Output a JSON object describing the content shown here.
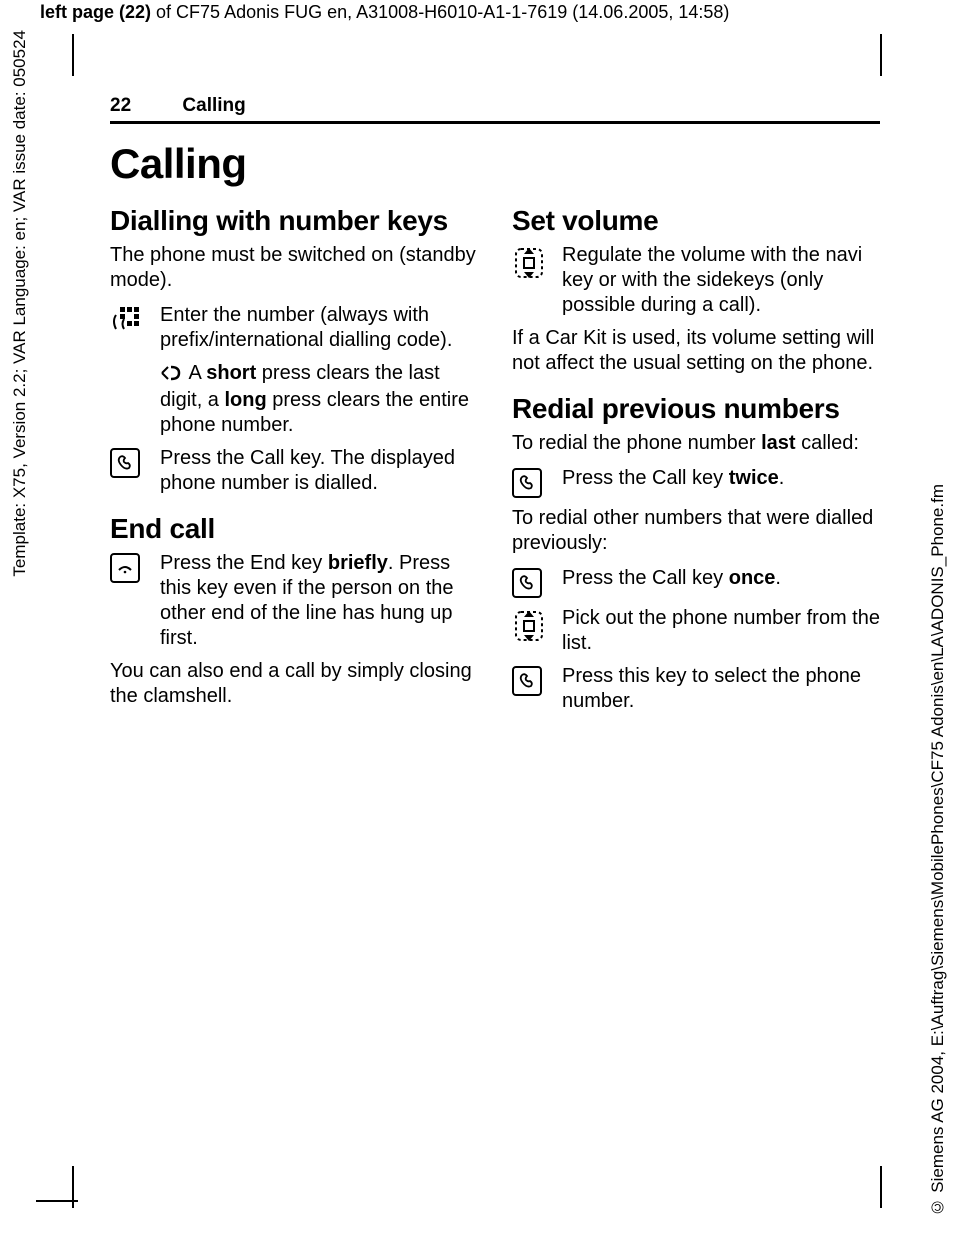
{
  "meta": {
    "top_banner_bold": "left page (22)",
    "top_banner_rest": " of CF75 Adonis FUG en, A31008-H6010-A1-1-7619 (14.06.2005, 14:58)",
    "vtext_left": "Template: X75, Version 2.2; VAR Language: en; VAR issue date: 050524",
    "vtext_right": "© Siemens AG 2004, E:\\Auftrag\\Siemens\\MobilePhones\\CF75 Adonis\\en\\LA\\ADONIS_Phone.fm"
  },
  "header": {
    "page_number": "22",
    "section": "Calling"
  },
  "title": "Calling",
  "left": {
    "h_dial": "Dialling with number keys",
    "dial_intro": "The phone must be switched on (standby mode).",
    "dial_enter": "Enter the number (always with prefix/international dialling code).",
    "dial_clear_pre": " A ",
    "dial_clear_short": "short",
    "dial_clear_mid": " press clears the last digit, a ",
    "dial_clear_long": "long",
    "dial_clear_post": " press clears the entire phone number.",
    "dial_call": "Press the Call key. The displayed phone number is dialled.",
    "h_end": "End call",
    "end_press_pre": "Press the End key ",
    "end_press_bold": "briefly",
    "end_press_post": ". Press this key even if the person on the other end of the line has hung up first.",
    "end_close": "You can also end a call by simply closing the clamshell."
  },
  "right": {
    "h_vol": "Set volume",
    "vol_text": "Regulate the volume with the navi key or with the sidekeys (only possible during a call).",
    "vol_carkit": "If a Car Kit is used, its volume setting will not affect the usual setting on the phone.",
    "h_redial": "Redial previous numbers",
    "redial_intro_pre": "To redial the phone number ",
    "redial_intro_bold": "last",
    "redial_intro_post": " called:",
    "redial_twice_pre": "Press the Call key ",
    "redial_twice_bold": "twice",
    "redial_twice_post": ".",
    "redial_other": "To redial other numbers that were dialled previously:",
    "redial_once_pre": "Press the Call key ",
    "redial_once_bold": "once",
    "redial_once_post": ".",
    "redial_pick": "Pick out the phone number from the list.",
    "redial_select": "Press this key to select the phone number."
  }
}
